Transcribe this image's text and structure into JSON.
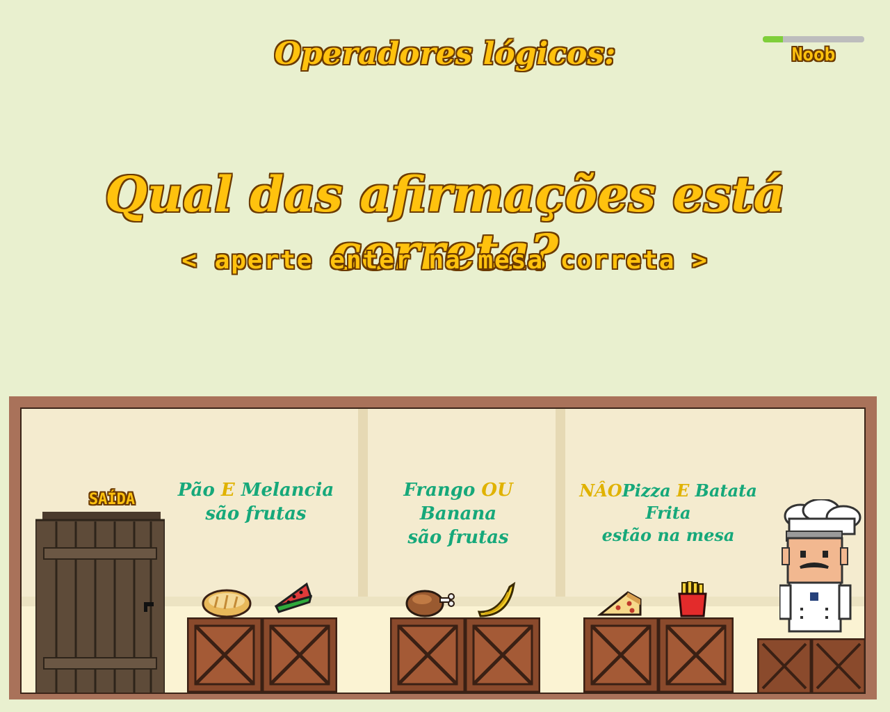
{
  "header": {
    "title": "Operadores lógicos:",
    "level_label": "Noob",
    "level_progress": 0.2
  },
  "question": {
    "text": "Qual das afirmações está correta?",
    "instruction": "< aperte enter na mesa correta >"
  },
  "scene": {
    "exit_label": "SAÍDA",
    "tables": [
      {
        "prefix": "",
        "item1": "Pão ",
        "operator": "E",
        "item2": " Melancia",
        "line2": "são frutas",
        "foods": [
          "bread-icon",
          "watermelon-icon"
        ]
      },
      {
        "prefix": "",
        "item1": "Frango ",
        "operator": "OU",
        "item2": " Banana",
        "line2": "são frutas",
        "foods": [
          "chicken-icon",
          "banana-icon"
        ]
      },
      {
        "prefix": "NÂO",
        "item1": "Pizza ",
        "operator": "E",
        "item2": " Batata Frita",
        "line2": "estão na mesa",
        "foods": [
          "pizza-icon",
          "fries-icon"
        ]
      }
    ]
  },
  "colors": {
    "background": "#e9f0cf",
    "title_fill": "#ffc20e",
    "title_outline": "#6b3a00",
    "sign_text": "#16a87a",
    "operator_text": "#e0b200",
    "progress": "#7fcf3a"
  }
}
